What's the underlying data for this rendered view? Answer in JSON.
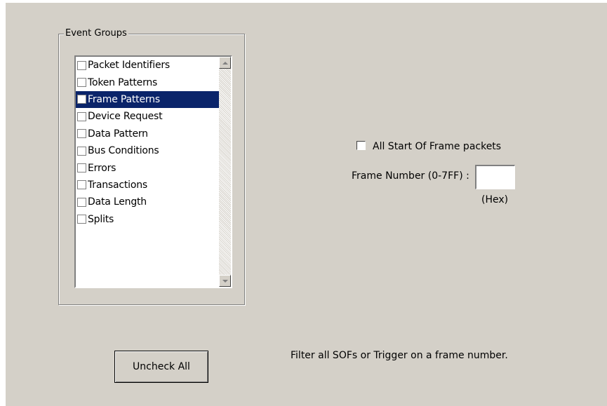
{
  "event_groups": {
    "title": "Event Groups",
    "items": [
      {
        "label": "Packet Identifiers",
        "checked": false,
        "selected": false
      },
      {
        "label": "Token Patterns",
        "checked": false,
        "selected": false
      },
      {
        "label": "Frame Patterns",
        "checked": false,
        "selected": true
      },
      {
        "label": "Device Request",
        "checked": false,
        "selected": false
      },
      {
        "label": "Data Pattern",
        "checked": false,
        "selected": false
      },
      {
        "label": "Bus Conditions",
        "checked": false,
        "selected": false
      },
      {
        "label": "Errors",
        "checked": false,
        "selected": false
      },
      {
        "label": "Transactions",
        "checked": false,
        "selected": false
      },
      {
        "label": "Data Length",
        "checked": false,
        "selected": false
      },
      {
        "label": "Splits",
        "checked": false,
        "selected": false
      }
    ]
  },
  "frame_options": {
    "sof_label": "All Start Of Frame packets",
    "sof_checked": false,
    "frame_number_label": "Frame Number (0-7FF) :",
    "frame_number_value": "",
    "hex_label": "(Hex)"
  },
  "buttons": {
    "uncheck_all": "Uncheck All"
  },
  "hint_text": "Filter all SOFs or Trigger on a frame number."
}
